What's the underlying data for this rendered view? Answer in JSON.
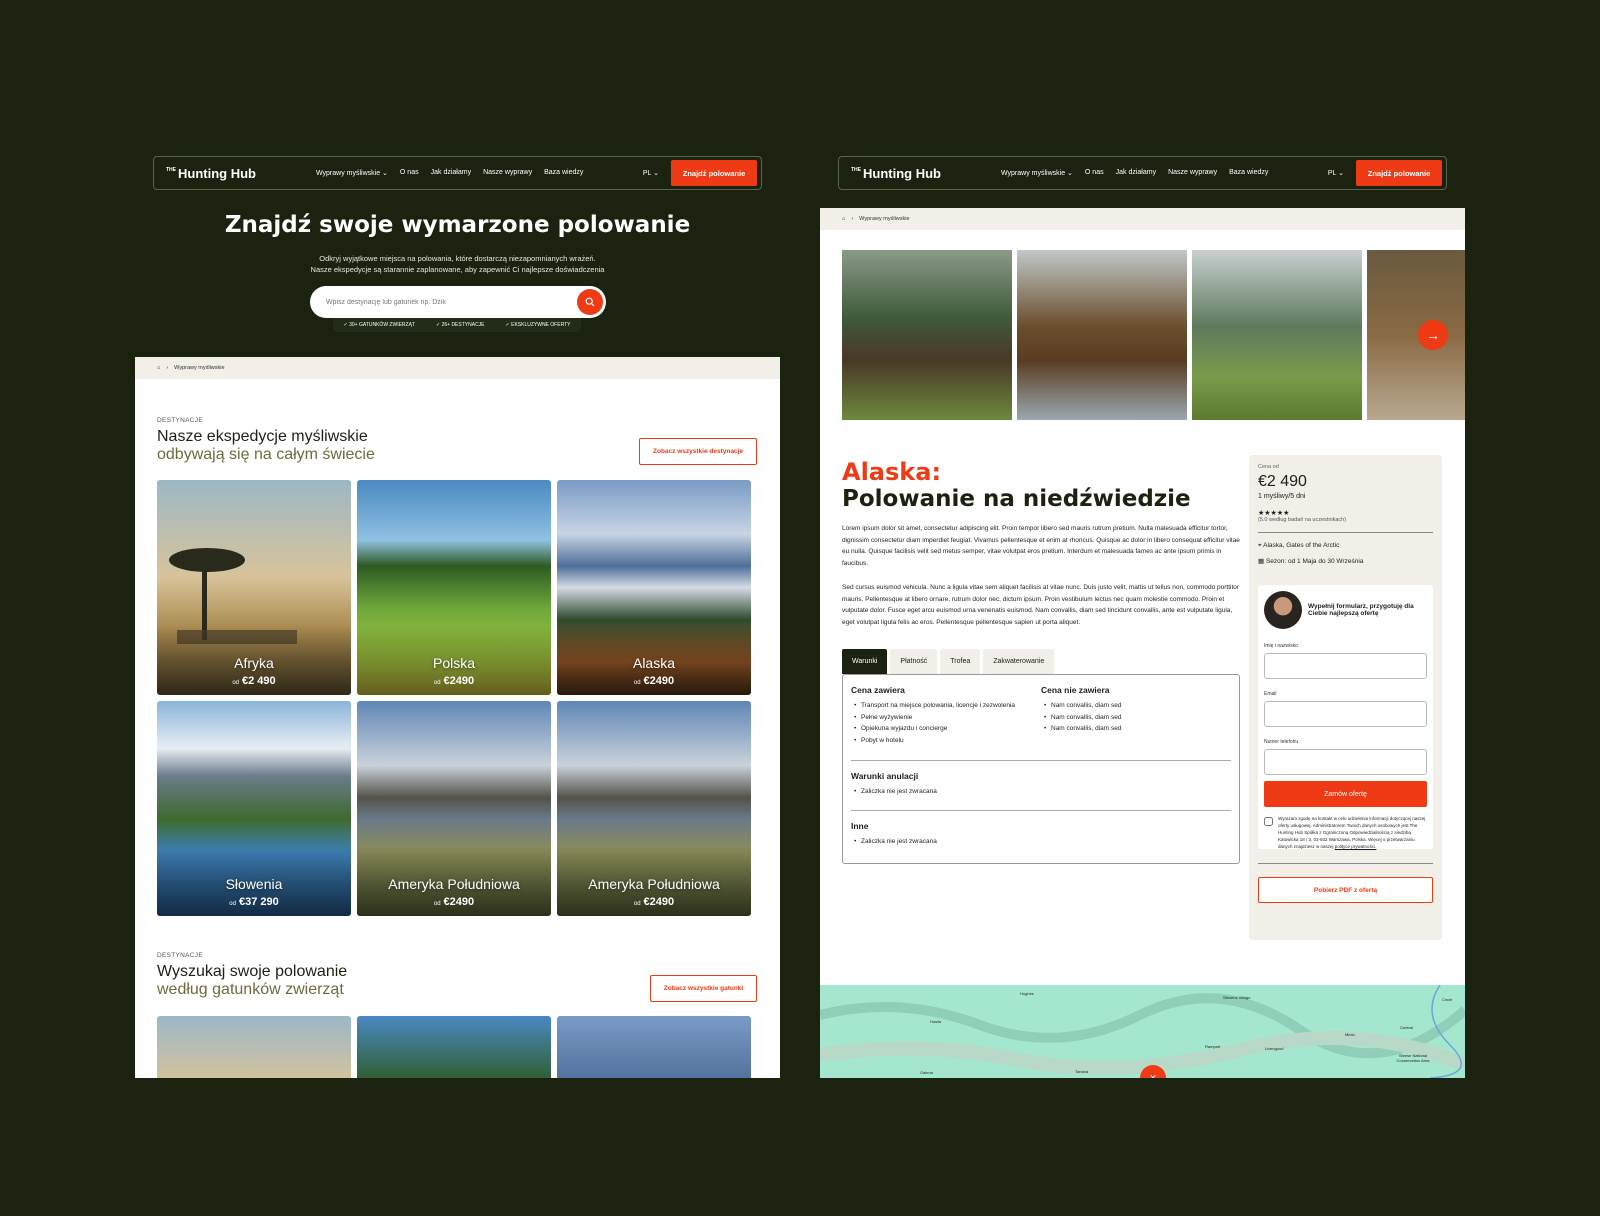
{
  "brand": {
    "prefix": "THE",
    "name": "Hunting Hub"
  },
  "nav": {
    "items": [
      "Wyprawy myśliwskie",
      "O nas",
      "Jak działamy",
      "Nasze wyprawy",
      "Baza wiedzy"
    ],
    "dropdown_chevron": "chevron-down-icon",
    "lang": "PL",
    "cta": "Znajdź polowanie"
  },
  "left": {
    "hero": {
      "title": "Znajdź swoje wymarzone polowanie",
      "subtitle_1": "Odkryj wyjątkowe miejsca na polowania, które dostarczą niezapomnianych wrażeń.",
      "subtitle_2": "Nasze ekspedycje są starannie zaplanowane, aby zapewnić Ci najlepsze doświadczenia",
      "search_placeholder": "Wpisz destynację lub gatunek np. Dzik",
      "badges": [
        "30+ GATUNKÓW ZWIERZĄT",
        "26+ DESTYNACJE",
        "EKSKLUZYWNE OFERTY"
      ]
    },
    "breadcrumb": "Wyprawy myśliwskie",
    "section1": {
      "label": "DESTYNACJE",
      "title_1": "Nasze ekspedycje myśliwskie",
      "title_2": "odbywają się na całym świecie",
      "button": "Zobacz wszystkie destynacje"
    },
    "destinations": [
      {
        "name": "Afryka",
        "prefix": "od",
        "price": "€2 490"
      },
      {
        "name": "Polska",
        "prefix": "od",
        "price": "€2490"
      },
      {
        "name": "Alaska",
        "prefix": "od",
        "price": "€2490"
      },
      {
        "name": "Słowenia",
        "prefix": "od",
        "price": "€37 290"
      },
      {
        "name": "Ameryka Południowa",
        "prefix": "od",
        "price": "€2490"
      },
      {
        "name": "Ameryka Południowa",
        "prefix": "od",
        "price": "€2490"
      }
    ],
    "section2": {
      "label": "DESTYNACJE",
      "title_1": "Wyszukaj swoje polowanie",
      "title_2": "według gatunków zwierząt",
      "button": "Zobacz wszystkie gatunki"
    }
  },
  "right": {
    "breadcrumb": "Wyprawy myśliwskie",
    "title_red": "Alaska:",
    "title_dark": "Polowanie na niedźwiedzie",
    "para1": "Lorem ipsum dolor sit amet, consectetur adipiscing elit. Proin tempor libero sed mauris rutrum pretium. Nulla malesuada efficitur tortor, dignissim consectetur diam imperdiet feugiat. Vivamus pellentesque et enim at rhoncus. Quisque ac dolor in libero consequat efficitur vitae eu nulla. Quisque facilisis velit sed metus semper, vitae volutpat eros pretium. Interdum et malesuada fames ac ante ipsum primis in faucibus.",
    "para2": "Sed cursus euismod vehicula. Nunc a ligula vitae sem aliquet facilisis at vitae nunc. Duis justo velit, mattis ut tellus non, commodo porttitor mauris. Pellentesque at libero ornare, rutrum dolor nec, dictum ipsum. Proin vestibulum lectus nec quam molestie commodo. Proin et vulputate dolor. Fusce eget arcu euismod urna venenatis euismod. Nam convallis, diam sed tincidunt convallis, ante est vulputate ligula, eget volutpat ligula felis ac eros. Pellentesque pellentesque sapien ut porta aliquet.",
    "tabs": [
      "Warunki",
      "Płatność",
      "Trofea",
      "Zakwaterowanie"
    ],
    "includes": {
      "title": "Cena zawiera",
      "items": [
        "Transport na miejsce polowania, licencje i zezwolenia",
        "Pełne wyżywienie",
        "Opiekuna wyjazdu i concierge",
        "Pobyt w hotelu"
      ]
    },
    "excludes": {
      "title": "Cena nie zawiera",
      "items": [
        "Nam convallis, diam sed",
        "Nam convallis, diam sed",
        "Nam convallis, diam sed"
      ]
    },
    "cancel": {
      "title": "Warunki anulacji",
      "items": [
        "Zaliczka nie jest zwracana"
      ]
    },
    "other": {
      "title": "Inne",
      "items": [
        "Zaliczka nie jest zwracana"
      ]
    },
    "sidebar": {
      "price_label": "Cena od",
      "price": "€2 490",
      "per": "1 myśliwy/5 dni",
      "stars": "★★★★★",
      "rating": "(5.0 według badań na uczestnikach)",
      "location": "Alaska, Gates of the Arctic",
      "season": "Sezon: od 1 Maja do 30 Września",
      "form_intro": "Wypełnij formularz, przygotuję dla Ciebie najlepszą ofertę",
      "name_label": "Imię i nazwisko",
      "email_label": "Email",
      "phone_label": "Numer telefonu",
      "submit": "Zamów ofertę",
      "consent": "Wyrażam zgodę na kontakt w celu udzielenia informacji dotyczącej naszej oferty usługowej. Administratorem Twoich danych osobowych jest The Hunting Hub Spółka z Ograniczoną Odpowiedzialnością z siedzibą Katowicka 18 / 3, 03-932 Warszawa, Polska. Więcej o przetwarzaniu danych znajdziesz w naszej",
      "consent_link": "polityce prywatności.",
      "pdf": "Pobierz PDF z ofertą"
    },
    "map_labels": [
      "Hughes",
      "Huslia",
      "Galena",
      "Tanana",
      "Livengood",
      "Central",
      "Circle",
      "Steese National Conservation Area",
      "Stevens Village",
      "Rampart",
      "Minto"
    ]
  },
  "colors": {
    "bg": "#1b2310",
    "accent": "#ef3b15",
    "olive": "#6d6b3c",
    "cream": "#f2eee8"
  }
}
